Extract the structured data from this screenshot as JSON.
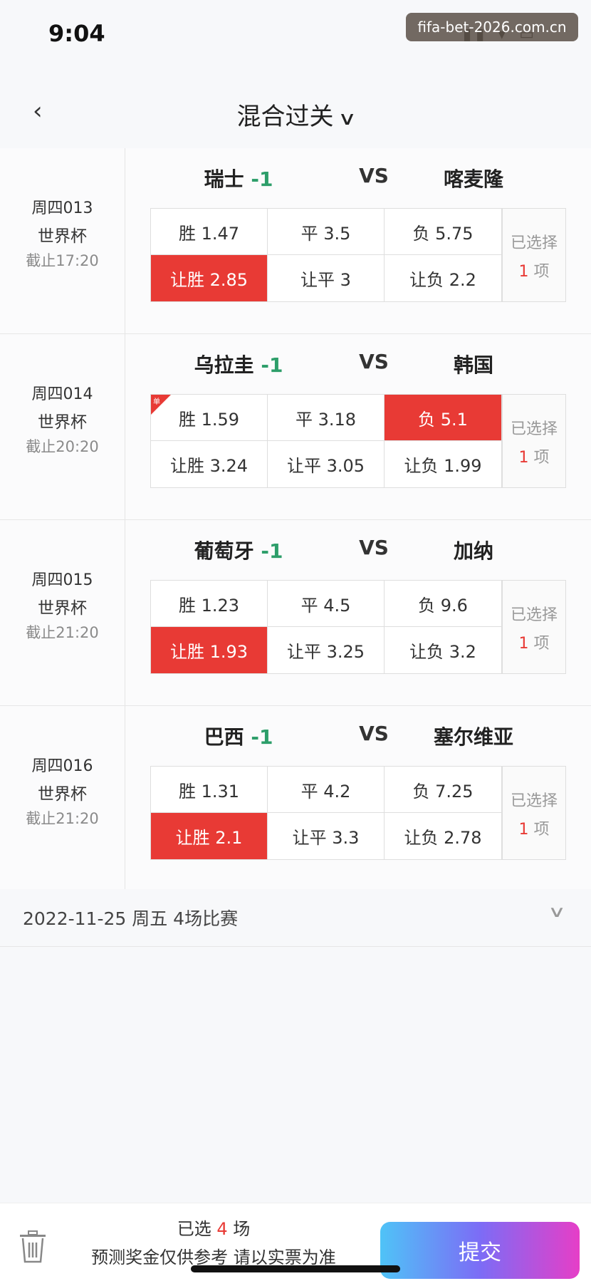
{
  "status": {
    "time": "9:04",
    "watermark": "fifa-bet-2026.com.cn"
  },
  "nav": {
    "title": "混合过关"
  },
  "matches": [
    {
      "code": "周四013",
      "league": "世界杯",
      "deadline": "截止17:20",
      "home": "瑞士",
      "handicap": "-1",
      "vs": "VS",
      "away": "喀麦隆",
      "odds": [
        "胜 1.47",
        "平 3.5",
        "负 5.75",
        "让胜 2.85",
        "让平 3",
        "让负 2.2"
      ],
      "selected_index": 3,
      "single": false,
      "selected_label": "已选择",
      "selected_count": "1",
      "selected_unit": "项"
    },
    {
      "code": "周四014",
      "league": "世界杯",
      "deadline": "截止20:20",
      "home": "乌拉圭",
      "handicap": "-1",
      "vs": "VS",
      "away": "韩国",
      "odds": [
        "胜 1.59",
        "平 3.18",
        "负 5.1",
        "让胜 3.24",
        "让平 3.05",
        "让负 1.99"
      ],
      "selected_index": 2,
      "single": true,
      "single_mark": "单",
      "selected_label": "已选择",
      "selected_count": "1",
      "selected_unit": "项"
    },
    {
      "code": "周四015",
      "league": "世界杯",
      "deadline": "截止21:20",
      "home": "葡萄牙",
      "handicap": "-1",
      "vs": "VS",
      "away": "加纳",
      "odds": [
        "胜 1.23",
        "平 4.5",
        "负 9.6",
        "让胜 1.93",
        "让平 3.25",
        "让负 3.2"
      ],
      "selected_index": 3,
      "single": false,
      "selected_label": "已选择",
      "selected_count": "1",
      "selected_unit": "项"
    },
    {
      "code": "周四016",
      "league": "世界杯",
      "deadline": "截止21:20",
      "home": "巴西",
      "handicap": "-1",
      "vs": "VS",
      "away": "塞尔维亚",
      "odds": [
        "胜 1.31",
        "平 4.2",
        "负 7.25",
        "让胜 2.1",
        "让平 3.3",
        "让负 2.78"
      ],
      "selected_index": 3,
      "single": false,
      "selected_label": "已选择",
      "selected_count": "1",
      "selected_unit": "项"
    }
  ],
  "date_group": {
    "label": "2022-11-25 周五 4场比赛"
  },
  "bottom": {
    "selected_prefix": "已选",
    "selected_count": "4",
    "selected_suffix": "场",
    "notice": "预测奖金仅供参考 请以实票为准",
    "submit_label": "提交"
  },
  "colors": {
    "selected": "#e83a35",
    "handicap": "#2d9e6a"
  }
}
